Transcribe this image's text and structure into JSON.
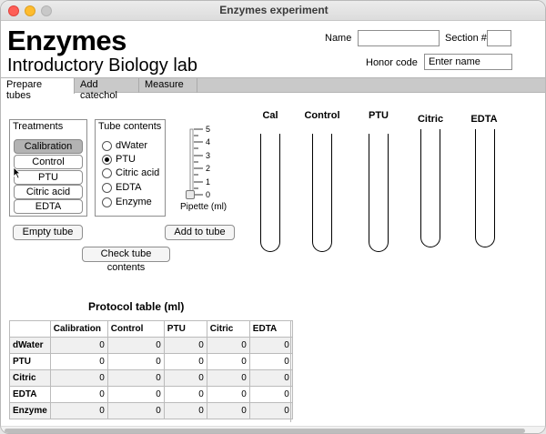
{
  "window": {
    "title": "Enzymes experiment"
  },
  "header": {
    "title": "Enzymes",
    "subtitle": "Introductory Biology lab",
    "name_label": "Name",
    "name_value": "",
    "section_label": "Section #",
    "section_value": "",
    "honor_label": "Honor code",
    "honor_placeholder": "Enter name"
  },
  "tabs": [
    {
      "label": "Prepare tubes",
      "active": true
    },
    {
      "label": "Add catechol",
      "active": false
    },
    {
      "label": "Measure",
      "active": false
    }
  ],
  "treatments": {
    "title": "Treatments",
    "items": [
      {
        "label": "Calibration",
        "selected": true
      },
      {
        "label": "Control",
        "selected": false
      },
      {
        "label": "PTU",
        "selected": false
      },
      {
        "label": "Citric acid",
        "selected": false
      },
      {
        "label": "EDTA",
        "selected": false
      }
    ]
  },
  "tube_contents": {
    "title": "Tube contents",
    "options": [
      {
        "label": "dWater",
        "checked": false
      },
      {
        "label": "PTU",
        "checked": true
      },
      {
        "label": "Citric acid",
        "checked": false
      },
      {
        "label": "EDTA",
        "checked": false
      },
      {
        "label": "Enzyme",
        "checked": false
      }
    ]
  },
  "pipette": {
    "label": "Pipette (ml)",
    "ticks": [
      "5",
      "4",
      "3",
      "2",
      "1",
      "0"
    ],
    "value": 0
  },
  "buttons": {
    "empty_tube": "Empty tube",
    "add_to_tube": "Add to tube",
    "check_contents": "Check tube contents"
  },
  "tubes": [
    {
      "label": "Cal"
    },
    {
      "label": "Control"
    },
    {
      "label": "PTU"
    },
    {
      "label": "Citric"
    },
    {
      "label": "EDTA"
    }
  ],
  "protocol": {
    "title": "Protocol table (ml)",
    "columns": [
      "",
      "Calibration",
      "Control",
      "PTU",
      "Citric",
      "EDTA"
    ],
    "rows": [
      {
        "name": "dWater",
        "values": [
          "0",
          "0",
          "0",
          "0",
          "0"
        ]
      },
      {
        "name": "PTU",
        "values": [
          "0",
          "0",
          "0",
          "0",
          "0"
        ]
      },
      {
        "name": "Citric",
        "values": [
          "0",
          "0",
          "0",
          "0",
          "0"
        ]
      },
      {
        "name": "EDTA",
        "values": [
          "0",
          "0",
          "0",
          "0",
          "0"
        ]
      },
      {
        "name": "Enzyme",
        "values": [
          "0",
          "0",
          "0",
          "0",
          "0"
        ]
      }
    ]
  }
}
